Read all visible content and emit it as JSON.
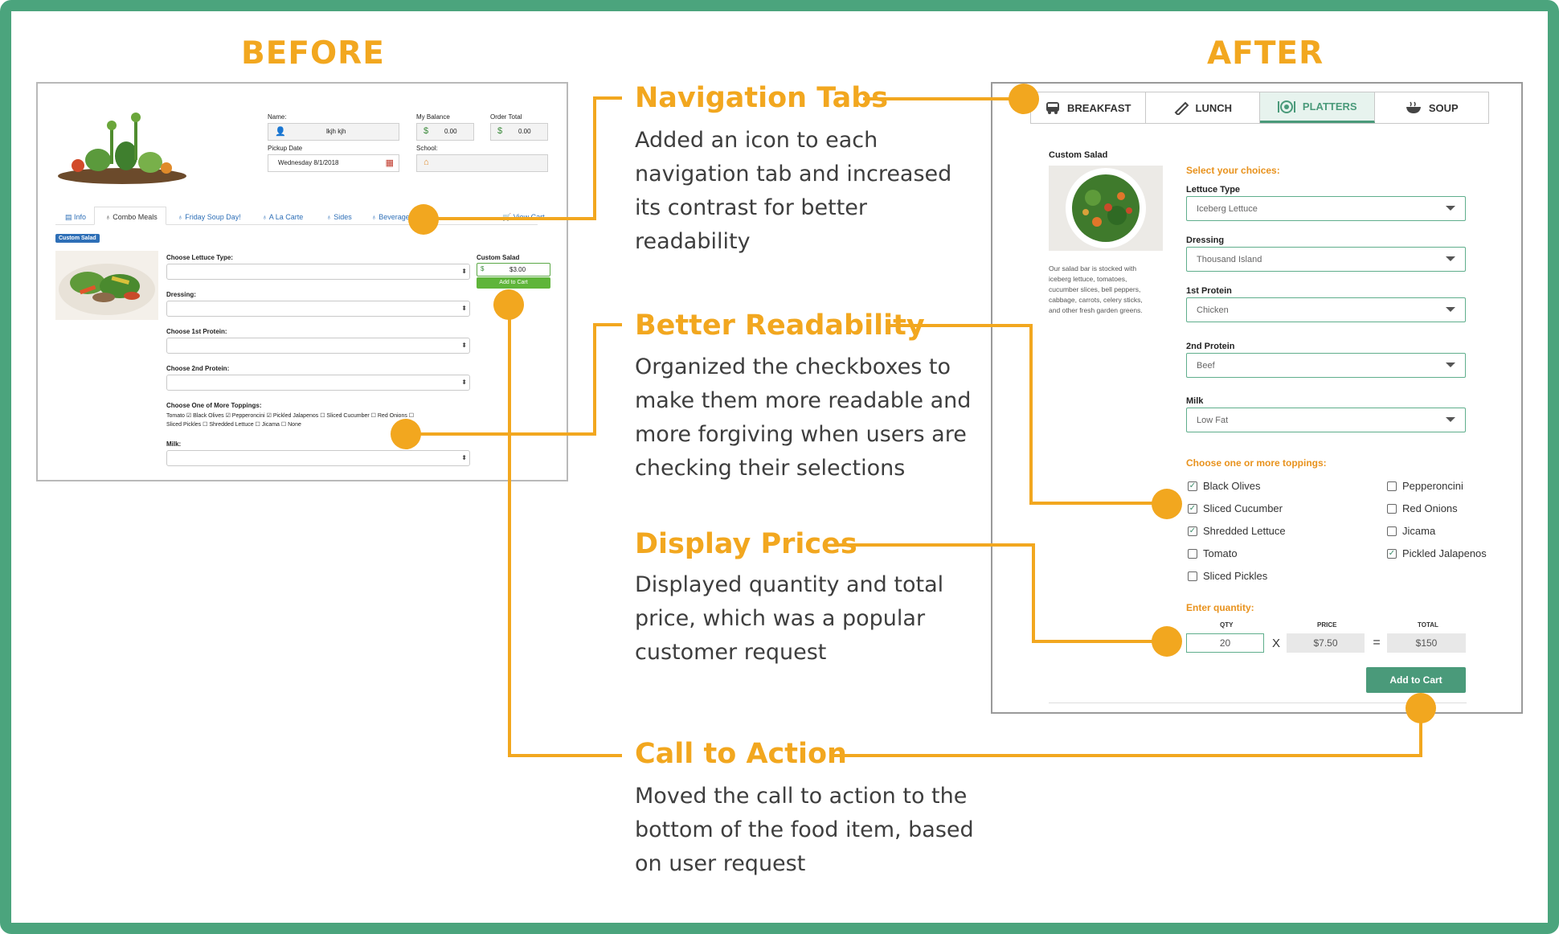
{
  "headings": {
    "before": "BEFORE",
    "after": "AFTER"
  },
  "annotations": [
    {
      "title": "Navigation Tabs",
      "body": "Added an icon to each navigation tab and increased its contrast for better readability"
    },
    {
      "title": "Better Readability",
      "body": "Organized the checkboxes to make them more readable and more forgiving when users are checking their selections"
    },
    {
      "title": "Display Prices",
      "body": "Displayed quantity and total price, which was a popular customer request"
    },
    {
      "title": "Call to Action",
      "body": "Moved the call to action to the bottom of the food item, based on user request"
    }
  ],
  "colors": {
    "accent": "#f2a71f",
    "frame": "#4ba47d",
    "brand_green": "#4a9a7a",
    "cta": "#4a9a7a"
  },
  "before": {
    "name_label": "Name:",
    "name_value": "lkjh kjh",
    "balance_label": "My Balance",
    "balance_value": "0.00",
    "order_total_label": "Order Total",
    "order_total_value": "0.00",
    "currency": "$",
    "pickup_label": "Pickup Date",
    "pickup_value": "Wednesday 8/1/2018",
    "school_label": "School:",
    "tabs": [
      "Info",
      "Combo Meals",
      "Friday Soup Day!",
      "A La Carte",
      "Sides",
      "Beverage",
      "View Cart"
    ],
    "badge": "Custom Salad",
    "lettuce_label": "Choose Lettuce Type:",
    "dressing_label": "Dressing:",
    "protein1_label": "Choose 1st Protein:",
    "protein2_label": "Choose 2nd Protein:",
    "toppings_label": "Choose One of More Toppings:",
    "toppings_row1": "Tomato ☑ Black Olives ☑ Pepperoncini ☑ Pickled Jalapenos ☐ Sliced Cucumber ☐ Red Onions ☐",
    "toppings_row2": "Sliced Pickles ☐ Shredded Lettuce ☐ Jicama ☐ None",
    "milk_label": "Milk:",
    "item_title": "Custom Salad",
    "item_price": "$3.00",
    "add_button": "Add to Cart"
  },
  "after": {
    "tabs": [
      {
        "label": "BREAKFAST",
        "icon": "bus-icon"
      },
      {
        "label": "LUNCH",
        "icon": "sandwich-icon"
      },
      {
        "label": "PLATTERS",
        "icon": "plate-icon",
        "active": true
      },
      {
        "label": "SOUP",
        "icon": "bowl-icon"
      }
    ],
    "item_title": "Custom Salad",
    "item_desc": "Our salad bar is stocked with iceberg lettuce, tomatoes, cucumber slices, bell peppers, cabbage, carrots, celery sticks, and other fresh garden greens.",
    "select_heading": "Select your choices:",
    "fields": [
      {
        "label": "Lettuce Type",
        "value": "Iceberg Lettuce"
      },
      {
        "label": "Dressing",
        "value": "Thousand Island"
      },
      {
        "label": "1st Protein",
        "value": "Chicken"
      },
      {
        "label": "2nd Protein",
        "value": "Beef"
      },
      {
        "label": "Milk",
        "value": "Low Fat"
      }
    ],
    "toppings_heading": "Choose one or more toppings:",
    "toppings": [
      {
        "label": "Black Olives",
        "checked": true
      },
      {
        "label": "Sliced Cucumber",
        "checked": true
      },
      {
        "label": "Shredded Lettuce",
        "checked": true
      },
      {
        "label": "Tomato",
        "checked": false
      },
      {
        "label": "Sliced Pickles",
        "checked": false
      },
      {
        "label": "Pepperoncini",
        "checked": false
      },
      {
        "label": "Red Onions",
        "checked": false
      },
      {
        "label": "Jicama",
        "checked": false
      },
      {
        "label": "Pickled Jalapenos",
        "checked": true
      }
    ],
    "quantity_heading": "Enter quantity:",
    "qty_head": "QTY",
    "price_head": "PRICE",
    "total_head": "TOTAL",
    "qty": "20",
    "times": "X",
    "price": "$7.50",
    "equals": "=",
    "total": "$150",
    "cta": "Add to Cart"
  }
}
